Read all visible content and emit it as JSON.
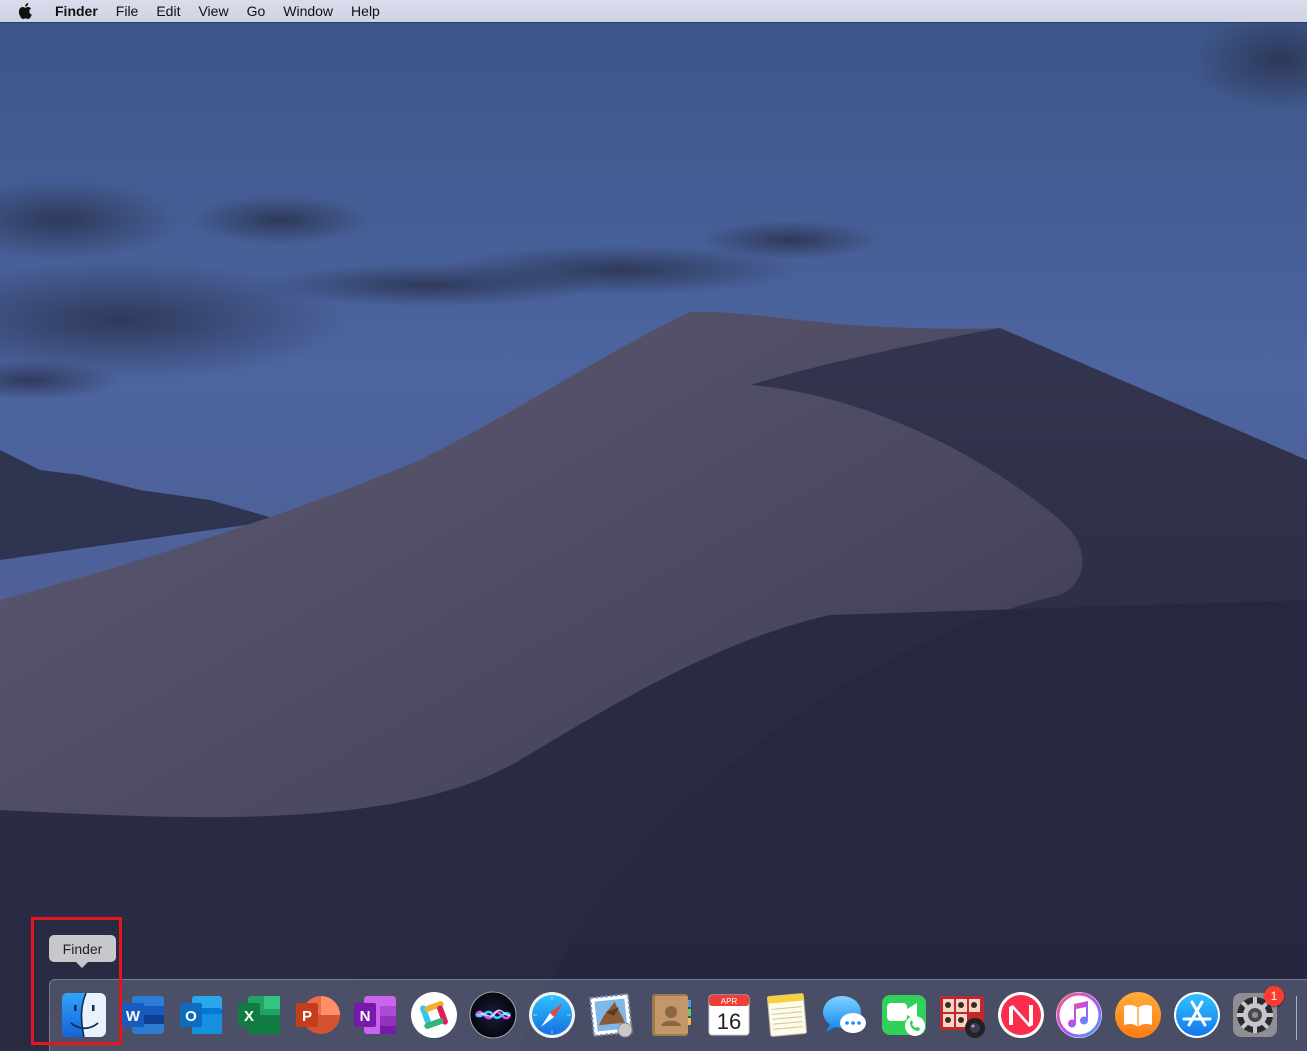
{
  "menubar": {
    "app_name": "Finder",
    "items": [
      "File",
      "Edit",
      "View",
      "Go",
      "Window",
      "Help"
    ]
  },
  "tooltip": {
    "text": "Finder"
  },
  "dock": {
    "icons": [
      {
        "name": "finder-icon"
      },
      {
        "name": "word-icon",
        "letter": "W"
      },
      {
        "name": "outlook-icon",
        "letter": "O"
      },
      {
        "name": "excel-icon",
        "letter": "X"
      },
      {
        "name": "powerpoint-icon",
        "letter": "P"
      },
      {
        "name": "onenote-icon",
        "letter": "N"
      },
      {
        "name": "slack-icon"
      },
      {
        "name": "siri-icon"
      },
      {
        "name": "safari-icon"
      },
      {
        "name": "mail-icon"
      },
      {
        "name": "contacts-icon"
      },
      {
        "name": "calendar-icon",
        "month": "APR",
        "day": "16"
      },
      {
        "name": "notes-icon"
      },
      {
        "name": "messages-icon"
      },
      {
        "name": "facetime-icon"
      },
      {
        "name": "photo-booth-icon"
      },
      {
        "name": "news-icon"
      },
      {
        "name": "itunes-icon"
      },
      {
        "name": "books-icon"
      },
      {
        "name": "app-store-icon"
      },
      {
        "name": "system-preferences-icon",
        "badge": "1"
      }
    ]
  },
  "colors": {
    "highlight": "#e4161d",
    "badge": "#ff3b30"
  }
}
